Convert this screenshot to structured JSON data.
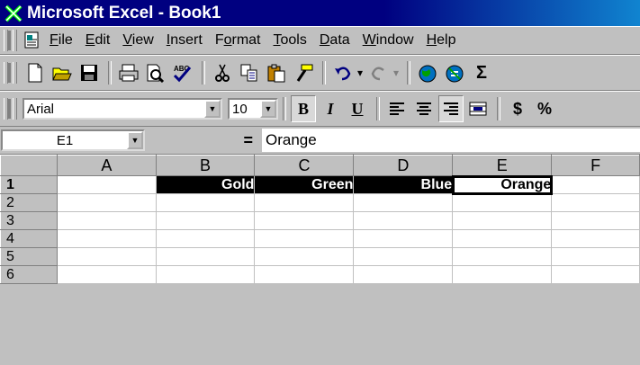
{
  "window": {
    "title": "Microsoft Excel - Book1"
  },
  "menu": [
    "File",
    "Edit",
    "View",
    "Insert",
    "Format",
    "Tools",
    "Data",
    "Window",
    "Help"
  ],
  "toolbar": {
    "icons": [
      "new-icon",
      "open-icon",
      "save-icon",
      "print-icon",
      "print-preview-icon",
      "spelling-icon",
      "cut-icon",
      "copy-icon",
      "paste-icon",
      "format-painter-icon",
      "undo-icon",
      "redo-icon",
      "web-toolbar-icon",
      "hyperlink-icon",
      "autosum-icon"
    ],
    "undo_drop": "▾",
    "redo_drop": "▾",
    "sigma": "Σ"
  },
  "format": {
    "font": "Arial",
    "size": "10",
    "bold": "B",
    "italic": "I",
    "underline": "U",
    "currency": "$",
    "percent": "%"
  },
  "formula_bar": {
    "name_box": "E1",
    "equals": "=",
    "value": "Orange"
  },
  "sheet": {
    "columns": [
      "A",
      "B",
      "C",
      "D",
      "E",
      "F"
    ],
    "rows": [
      "1",
      "2",
      "3",
      "4",
      "5",
      "6"
    ],
    "row1": [
      "",
      "Gold",
      "Green",
      "Blue",
      "Orange",
      ""
    ]
  },
  "colors": {
    "title_bar": "#000080",
    "chrome": "#c0c0c0",
    "selection": "#000000"
  }
}
